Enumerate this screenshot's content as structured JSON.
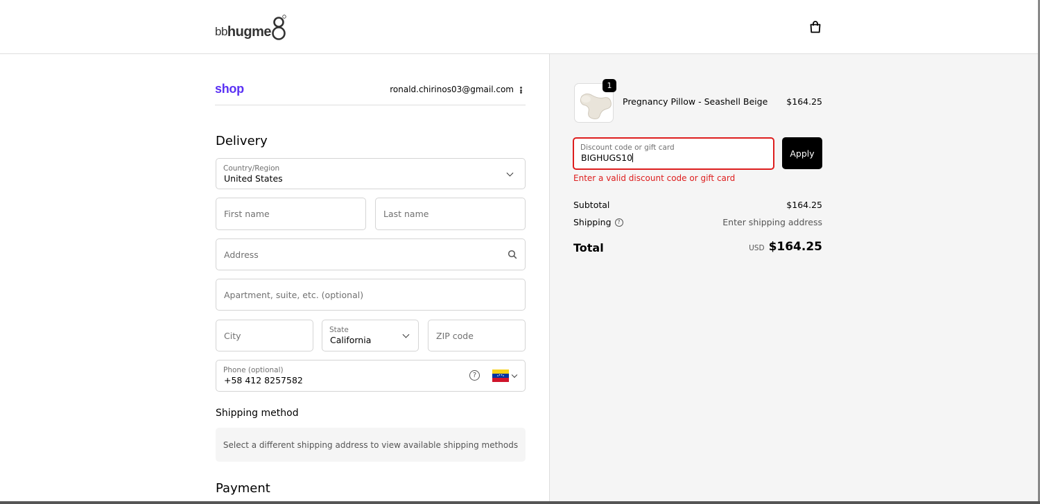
{
  "header": {
    "logo_prefix": "bb",
    "logo_main": "hugme",
    "logo_suffix": "8",
    "bag_icon": "shopping-bag-icon"
  },
  "shop": {
    "logo": "shop",
    "email": "ronald.chirinos03@gmail.com"
  },
  "delivery": {
    "heading": "Delivery",
    "country_label": "Country/Region",
    "country_value": "United States",
    "first_name_placeholder": "First name",
    "last_name_placeholder": "Last name",
    "address_placeholder": "Address",
    "apartment_placeholder": "Apartment, suite, etc. (optional)",
    "city_placeholder": "City",
    "state_label": "State",
    "state_value": "California",
    "zip_placeholder": "ZIP code",
    "phone_label": "Phone (optional)",
    "phone_value": "+58 412 8257582"
  },
  "shipping": {
    "heading": "Shipping method",
    "message": "Select a different shipping address to view available shipping methods"
  },
  "payment": {
    "heading": "Payment"
  },
  "order": {
    "quantity": "1",
    "product_name": "Pregnancy Pillow - Seashell Beige",
    "product_price": "$164.25",
    "discount_label": "Discount code or gift card",
    "discount_value": "BIGHUGS10",
    "apply_label": "Apply",
    "error": "Enter a valid discount code or gift card",
    "subtotal_label": "Subtotal",
    "subtotal_value": "$164.25",
    "shipping_label": "Shipping",
    "shipping_value": "Enter shipping address",
    "total_label": "Total",
    "currency": "USD",
    "total_value": "$164.25"
  },
  "colors": {
    "shop_purple": "#5a31f4",
    "error_red": "#dd1d1d",
    "button_black": "#000000",
    "summary_bg": "#f5f5f5"
  }
}
